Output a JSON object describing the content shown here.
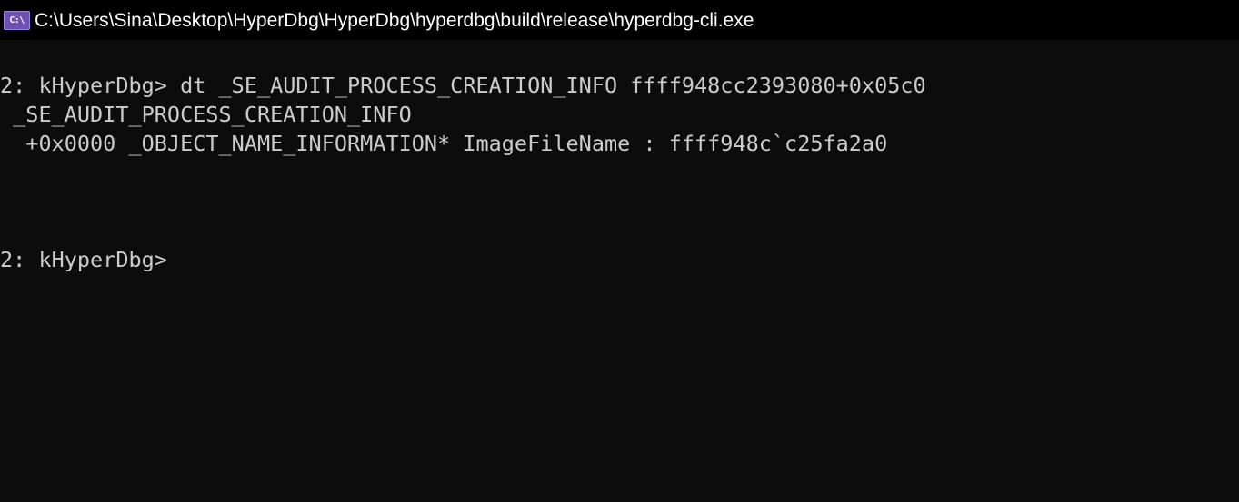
{
  "window": {
    "icon_label": "C:\\",
    "title": "C:\\Users\\Sina\\Desktop\\HyperDbg\\HyperDbg\\hyperdbg\\build\\release\\hyperdbg-cli.exe"
  },
  "console": {
    "lines": [
      "2: kHyperDbg> dt _SE_AUDIT_PROCESS_CREATION_INFO ffff948cc2393080+0x05c0",
      " _SE_AUDIT_PROCESS_CREATION_INFO",
      "  +0x0000 _OBJECT_NAME_INFORMATION* ImageFileName : ffff948c`c25fa2a0"
    ],
    "prompt": "2: kHyperDbg>"
  },
  "colors": {
    "background": "#0c0c0c",
    "titlebar": "#000000",
    "text": "#cccccc",
    "icon": "#6e4fb3"
  }
}
